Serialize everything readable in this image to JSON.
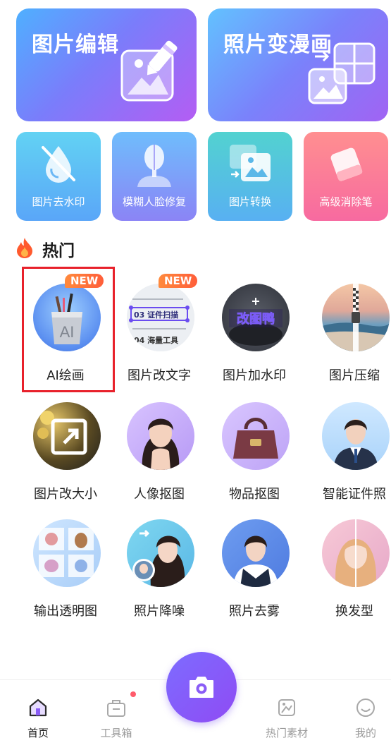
{
  "feature_cards": [
    {
      "label": "图片编辑",
      "icon": "image-pen-icon"
    },
    {
      "label": "照片变漫画",
      "icon": "photo-to-comic-icon"
    }
  ],
  "tool_cards": [
    {
      "label": "图片去水印",
      "icon": "remove-watermark-icon"
    },
    {
      "label": "模糊人脸修复",
      "icon": "face-restore-icon"
    },
    {
      "label": "图片转换",
      "icon": "image-convert-icon"
    },
    {
      "label": "高级消除笔",
      "icon": "eraser-icon"
    }
  ],
  "hot_section": {
    "title": "热门",
    "icon": "fire-icon",
    "items": [
      {
        "label": "AI绘画",
        "badge": "NEW",
        "thumb_text": "AI"
      },
      {
        "label": "图片改文字",
        "badge": "NEW",
        "thumb_lines": [
          "03 证件扫描",
          "04 海量工具"
        ]
      },
      {
        "label": "图片加水印",
        "thumb_text": "改图鸭"
      },
      {
        "label": "图片压缩"
      },
      {
        "label": "图片改大小"
      },
      {
        "label": "人像抠图"
      },
      {
        "label": "物品抠图"
      },
      {
        "label": "智能证件照"
      },
      {
        "label": "输出透明图"
      },
      {
        "label": "照片降噪"
      },
      {
        "label": "照片去雾"
      },
      {
        "label": "换发型"
      }
    ]
  },
  "bottom_nav": {
    "items": [
      {
        "label": "首页",
        "icon": "home-icon",
        "active": true
      },
      {
        "label": "工具箱",
        "icon": "toolbox-icon",
        "has_dot": true
      },
      {
        "label": "热门素材",
        "icon": "hot-material-icon"
      },
      {
        "label": "我的",
        "icon": "profile-icon"
      }
    ],
    "camera_icon": "camera-icon"
  },
  "colors": {
    "accent": "#8a5cf6",
    "highlight_border": "#e8212b",
    "badge": "#ff6a3c"
  }
}
